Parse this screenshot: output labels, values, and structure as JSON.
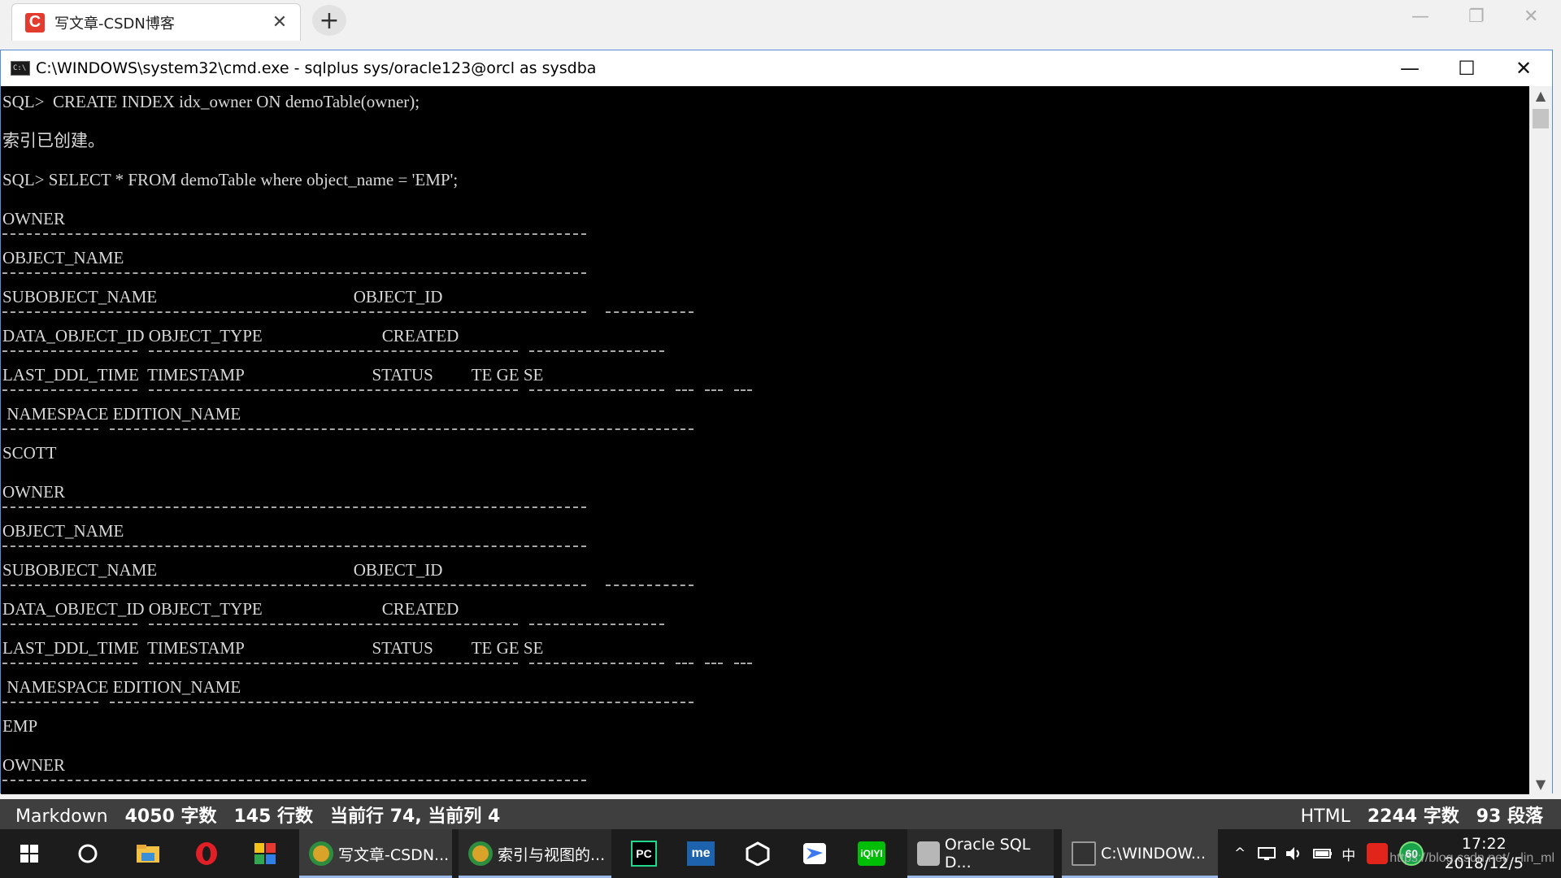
{
  "browser": {
    "tab_title": "写文章-CSDN博客",
    "tab_logo": "C",
    "close_glyph": "✕",
    "new_tab_glyph": "+",
    "controls": {
      "minimize": "—",
      "restore": "❐",
      "close": "✕"
    }
  },
  "cmd": {
    "title": "C:\\WINDOWS\\system32\\cmd.exe - sqlplus  sys/oracle123@orcl as sysdba",
    "controls": {
      "minimize": "—",
      "maximize": "☐",
      "close": "✕"
    },
    "lines": [
      "SQL>  CREATE INDEX idx_owner ON demoTable(owner);",
      "索引已创建。",
      "SQL> SELECT * FROM demoTable where object_name = 'EMP';",
      "OWNER",
      "OBJECT_NAME",
      "SUBOBJECT_NAME                                              OBJECT_ID",
      "DATA_OBJECT_ID OBJECT_TYPE                            CREATED",
      "LAST_DDL_TIME  TIMESTAMP                              STATUS         TE GE SE",
      " NAMESPACE EDITION_NAME",
      "SCOTT",
      "OWNER",
      "OBJECT_NAME",
      "SUBOBJECT_NAME                                              OBJECT_ID",
      "DATA_OBJECT_ID OBJECT_TYPE                            CREATED",
      "LAST_DDL_TIME  TIMESTAMP                              STATUS         TE GE SE",
      " NAMESPACE EDITION_NAME",
      "EMP",
      "OWNER"
    ],
    "scroll_up": "▲",
    "scroll_down": "▼"
  },
  "statusbar": {
    "mode": "Markdown",
    "chars": "4050 字数",
    "lines": "145 行数",
    "cursor": "当前行 74, 当前列 4",
    "right_mode": "HTML",
    "right_chars": "2244 字数",
    "right_paras": "93 段落"
  },
  "taskbar": {
    "apps": [
      {
        "label": "写文章-CSDN...",
        "icon": "chrome-icon",
        "color": "#d9a32a"
      },
      {
        "label": "索引与视图的...",
        "icon": "chrome-icon",
        "color": "#d9a32a"
      },
      {
        "label": "Oracle SQL D...",
        "icon": "oracle-sql-developer-icon",
        "color": "#b7b7b7"
      },
      {
        "label": "C:\\WINDOW...",
        "icon": "cmd-icon",
        "color": "#333333"
      }
    ],
    "pinned": [
      {
        "label": "PC",
        "icon": "pycharm-icon",
        "color": "#21d789"
      },
      {
        "label": "me",
        "icon": "markdown-editor-icon",
        "color": "#1d62ad"
      }
    ],
    "tray": {
      "ime": "中",
      "badge": "60",
      "chevron": "^"
    },
    "clock_time": "17:22",
    "clock_date": "2018/12/5"
  },
  "watermark": "https://blog.csdn.net/...lin_ml"
}
